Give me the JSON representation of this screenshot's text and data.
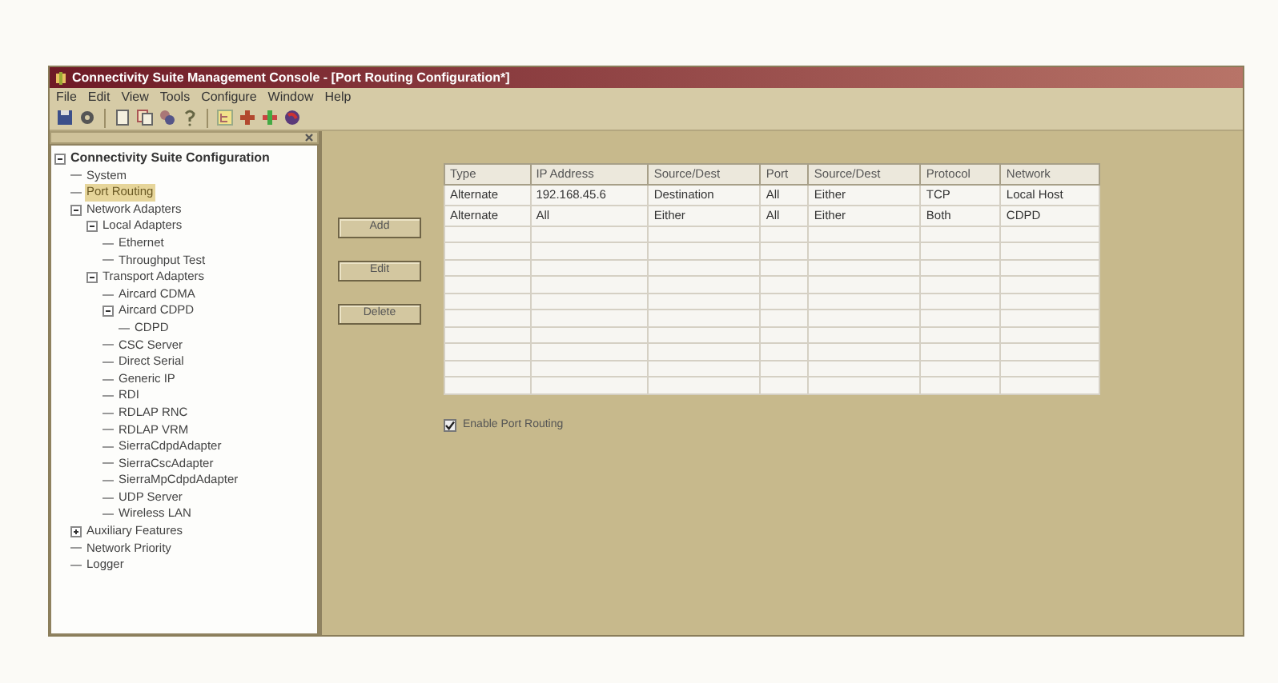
{
  "window": {
    "title": "Connectivity Suite Management Console - [Port Routing Configuration*]"
  },
  "menu": [
    "File",
    "Edit",
    "View",
    "Tools",
    "Configure",
    "Window",
    "Help"
  ],
  "tree": {
    "label": "Connectivity Suite Configuration",
    "expanded": true,
    "selected": false,
    "children": [
      {
        "label": "System",
        "selected": false
      },
      {
        "label": "Port Routing",
        "selected": true
      },
      {
        "label": "Network Adapters",
        "expanded": true,
        "selected": false,
        "children": [
          {
            "label": "Local Adapters",
            "expanded": true,
            "selected": false,
            "children": [
              {
                "label": "Ethernet",
                "selected": false
              },
              {
                "label": "Throughput Test",
                "selected": false
              }
            ]
          },
          {
            "label": "Transport Adapters",
            "expanded": true,
            "selected": false,
            "children": [
              {
                "label": "Aircard CDMA",
                "selected": false
              },
              {
                "label": "Aircard CDPD",
                "expanded": true,
                "selected": false,
                "children": [
                  {
                    "label": "CDPD",
                    "selected": false
                  }
                ]
              },
              {
                "label": "CSC Server",
                "selected": false
              },
              {
                "label": "Direct Serial",
                "selected": false
              },
              {
                "label": "Generic IP",
                "selected": false
              },
              {
                "label": "RDI",
                "selected": false
              },
              {
                "label": "RDLAP RNC",
                "selected": false
              },
              {
                "label": "RDLAP VRM",
                "selected": false
              },
              {
                "label": "SierraCdpdAdapter",
                "selected": false
              },
              {
                "label": "SierraCscAdapter",
                "selected": false
              },
              {
                "label": "SierraMpCdpdAdapter",
                "selected": false
              },
              {
                "label": "UDP Server",
                "selected": false
              },
              {
                "label": "Wireless LAN",
                "selected": false
              }
            ]
          }
        ]
      },
      {
        "label": "Auxiliary Features",
        "expanded": false,
        "selected": false
      },
      {
        "label": "Network Priority",
        "selected": false
      },
      {
        "label": "Logger",
        "selected": false
      }
    ]
  },
  "buttons": [
    "Add",
    "Edit",
    "Delete"
  ],
  "table": {
    "columns": [
      "Type",
      "IP Address",
      "Source/Dest",
      "Port",
      "Source/Dest",
      "Protocol",
      "Network"
    ],
    "rows": [
      [
        "Alternate",
        "192.168.45.6",
        "Destination",
        "All",
        "Either",
        "TCP",
        "Local Host"
      ],
      [
        "Alternate",
        "All",
        "Either",
        "All",
        "Either",
        "Both",
        "CDPD"
      ]
    ]
  },
  "enable_port_routing": {
    "label": "Enable Port Routing",
    "checked": true
  }
}
